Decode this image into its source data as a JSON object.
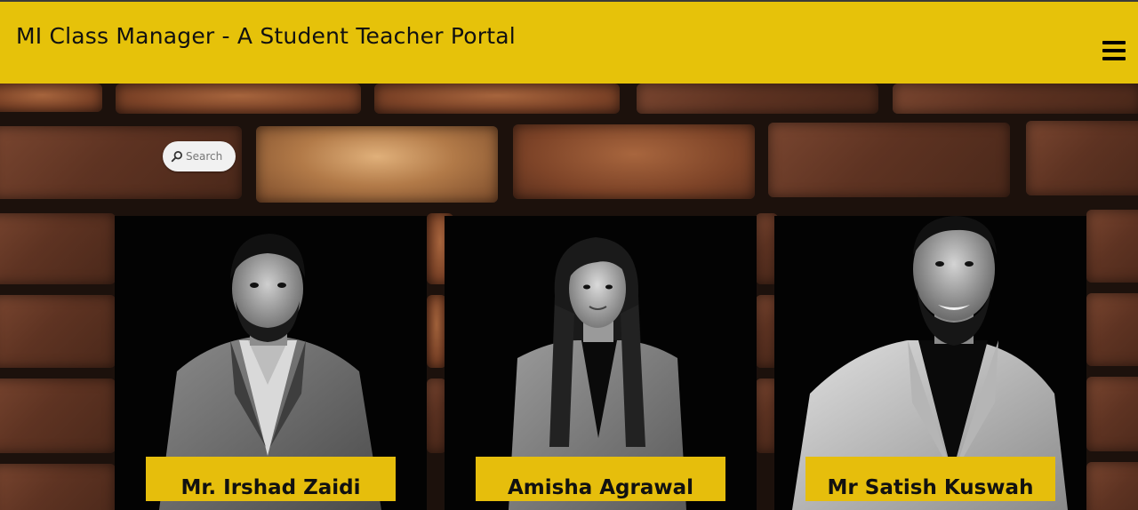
{
  "header": {
    "title": "MI Class Manager - A Student Teacher Portal",
    "menu_icon": "hamburger-menu-icon",
    "background_color": "#e6c20a"
  },
  "search": {
    "placeholder": "Search",
    "icon": "search-icon"
  },
  "teachers": [
    {
      "name": "Mr. Irshad Zaidi"
    },
    {
      "name": "Amisha Agrawal"
    },
    {
      "name": "Mr Satish Kuswah"
    }
  ],
  "colors": {
    "accent": "#e6be0c",
    "card_background": "#020202",
    "wall": "#5e3322"
  }
}
